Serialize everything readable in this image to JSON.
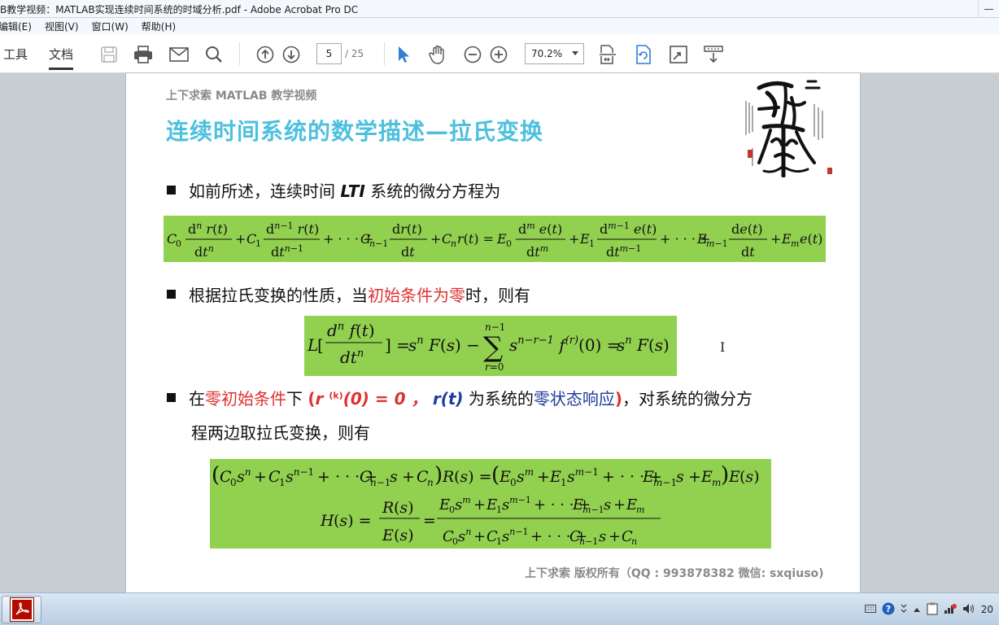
{
  "window": {
    "title": "B教学视频：MATLAB实现连续时间系统的时域分析.pdf - Adobe Acrobat Pro DC",
    "minimize": "—",
    "maximize": "▢",
    "close": "✕"
  },
  "menu": {
    "items": [
      "编辑(E)",
      "视图(V)",
      "窗口(W)",
      "帮助(H)"
    ]
  },
  "toolbar": {
    "tab_tools": "工具",
    "tab_document": "文档",
    "current_page": "5",
    "total_pages": "/ 25",
    "zoom": "70.2%"
  },
  "slide": {
    "subtitle": "上下求索 MATLAB 教学视频",
    "title": "连续时间系统的数学描述—拉氏变换",
    "bullet1": {
      "a": "如前所述，连续时间 ",
      "lti": "LTI",
      "b": " 系统的微分方程为"
    },
    "bullet2": {
      "a": "根据拉氏变换的性质，当",
      "highlight": "初始条件为零",
      "b": "时，则有"
    },
    "bullet3": {
      "a": "在",
      "highlight": "零初始条件",
      "b": "下 ",
      "open": "(",
      "cond": "r ",
      "cond_sup": "(k)",
      "cond_rest": "(0) = 0 ，",
      "rt": "r(t)",
      "c": " 为系统的",
      "zsr": "零状态响应",
      "close": ")",
      "d": "，对系统的微分方",
      "line2": "程两边取拉氏变换，则有"
    },
    "copyright": "上下求索  版权所有（QQ : 993878382   微信: sxqiuso)"
  },
  "taskbar": {
    "clock": "20"
  },
  "colors": {
    "title_cyan": "#4dc0de",
    "equation_green": "#92d050",
    "highlight_red": "#e03131",
    "highlight_blue": "#1f3c9c"
  }
}
